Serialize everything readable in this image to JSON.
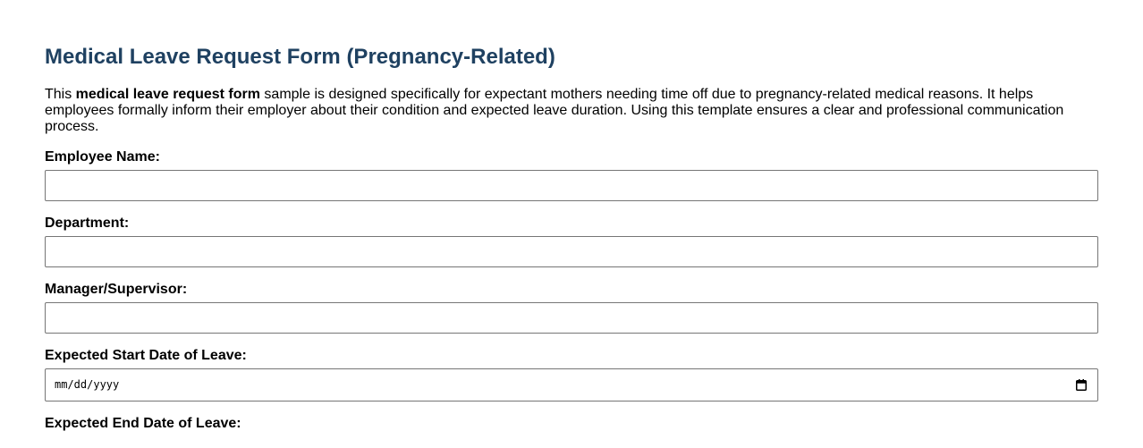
{
  "form": {
    "title": "Medical Leave Request Form (Pregnancy-Related)",
    "intro_prefix": "This ",
    "intro_bold": "medical leave request form",
    "intro_suffix": " sample is designed specifically for expectant mothers needing time off due to pregnancy-related medical reasons. It helps employees formally inform their employer about their condition and expected leave duration. Using this template ensures a clear and professional communication process.",
    "fields": {
      "employee_name": {
        "label": "Employee Name:",
        "value": ""
      },
      "department": {
        "label": "Department:",
        "value": ""
      },
      "manager": {
        "label": "Manager/Supervisor:",
        "value": ""
      },
      "start_date": {
        "label": "Expected Start Date of Leave:",
        "placeholder": "mm/dd/yyyy",
        "icon": "calendar-icon"
      },
      "end_date": {
        "label": "Expected End Date of Leave:"
      }
    }
  },
  "colors": {
    "title": "#1f4161",
    "input_border": "#767676"
  }
}
